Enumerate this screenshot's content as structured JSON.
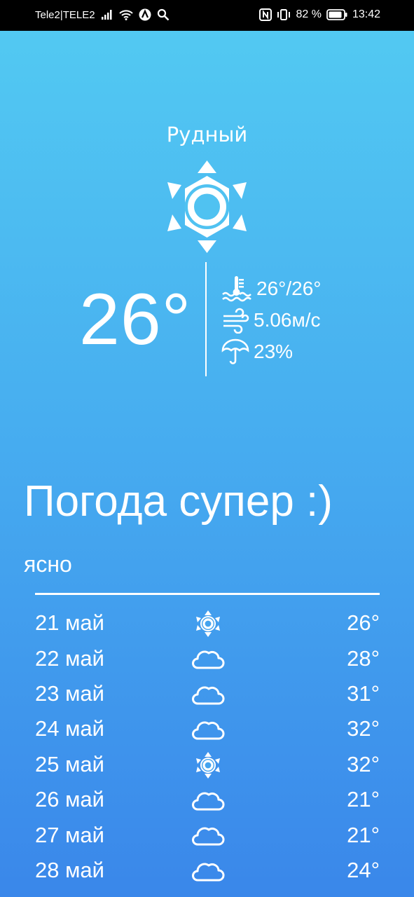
{
  "status_bar": {
    "carrier": "Tele2|TELE2",
    "battery": "82 %",
    "time": "13:42"
  },
  "current": {
    "city": "Рудный",
    "icon": "sun-icon",
    "temperature": "26°",
    "feels_like": "26°/26°",
    "wind": "5.06м/с",
    "precipitation": "23%"
  },
  "mood": "Погода супер :)",
  "description": "ясно",
  "forecast": [
    {
      "date": "21 май",
      "icon": "sun",
      "temp": "26°"
    },
    {
      "date": "22 май",
      "icon": "cloud",
      "temp": "28°"
    },
    {
      "date": "23 май",
      "icon": "cloud",
      "temp": "31°"
    },
    {
      "date": "24 май",
      "icon": "cloud",
      "temp": "32°"
    },
    {
      "date": "25 май",
      "icon": "sun",
      "temp": "32°"
    },
    {
      "date": "26 май",
      "icon": "cloud",
      "temp": "21°"
    },
    {
      "date": "27 май",
      "icon": "cloud",
      "temp": "21°"
    },
    {
      "date": "28 май",
      "icon": "cloud",
      "temp": "24°"
    }
  ]
}
